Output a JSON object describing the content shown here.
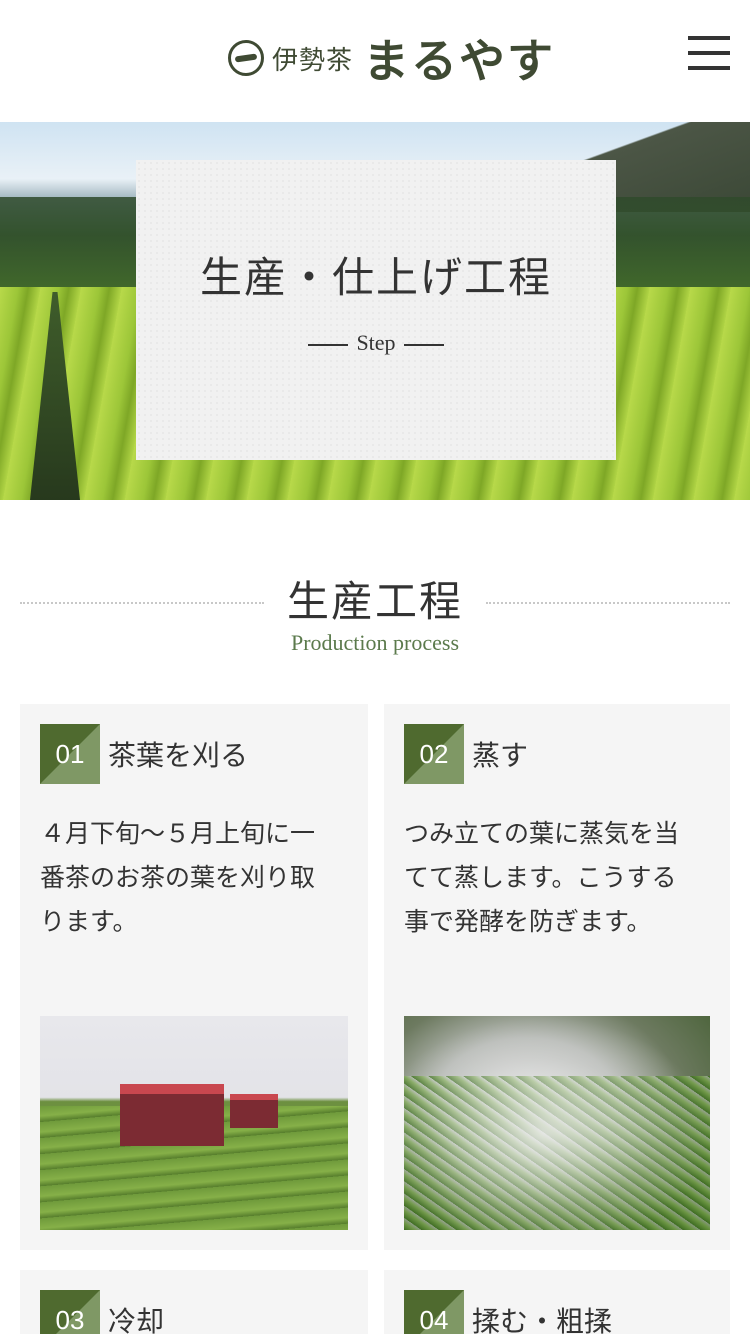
{
  "header": {
    "logo_small": "伊勢茶",
    "logo_big": "まるやす",
    "menu_icon": "hamburger-menu-icon"
  },
  "hero": {
    "title": "生産・仕上げ工程",
    "subtitle": "Step"
  },
  "section": {
    "title": "生産工程",
    "subtitle": "Production process"
  },
  "cards": [
    {
      "num": "01",
      "title": "茶葉を刈る",
      "text": "４月下旬～５月上旬に一番茶のお茶の葉を刈り取ります。"
    },
    {
      "num": "02",
      "title": "蒸す",
      "text": "つみ立ての葉に蒸気を当てて蒸します。こうする事で発酵を防ぎます。"
    },
    {
      "num": "03",
      "title": "冷却",
      "text": ""
    },
    {
      "num": "04",
      "title": "揉む・粗揉",
      "text": ""
    }
  ],
  "colors": {
    "brand_green": "#4f6a2f",
    "accent_green": "#7f9865",
    "subtitle_green": "#5b7a4c"
  }
}
